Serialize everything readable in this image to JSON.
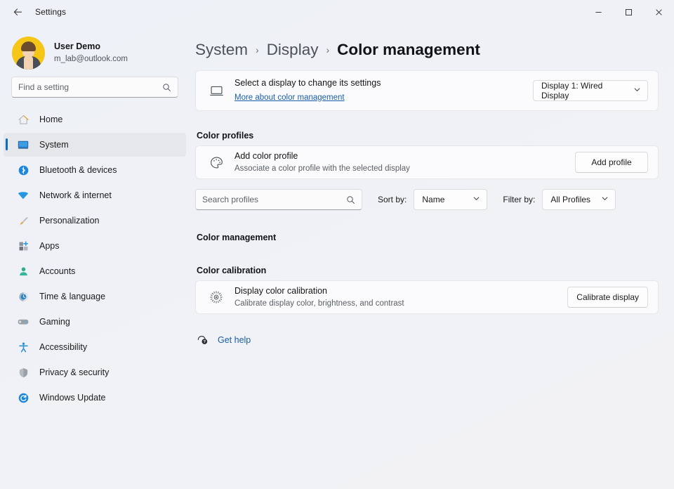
{
  "window": {
    "title": "Settings",
    "back_icon": "back-arrow-icon",
    "minimize_label": "—",
    "maximize_label": "☐",
    "close_label": "✕"
  },
  "account": {
    "name": "User Demo",
    "email": "m_lab@outlook.com",
    "avatar_name": "user-avatar"
  },
  "search": {
    "placeholder": "Find a setting",
    "value": "",
    "icon": "search-icon"
  },
  "sidebar": {
    "items": [
      {
        "label": "Home",
        "icon": "home-icon",
        "active": false
      },
      {
        "label": "System",
        "icon": "system-monitor-icon",
        "active": true
      },
      {
        "label": "Bluetooth & devices",
        "icon": "bluetooth-icon",
        "active": false
      },
      {
        "label": "Network & internet",
        "icon": "wifi-icon",
        "active": false
      },
      {
        "label": "Personalization",
        "icon": "paintbrush-icon",
        "active": false
      },
      {
        "label": "Apps",
        "icon": "apps-icon",
        "active": false
      },
      {
        "label": "Accounts",
        "icon": "account-person-icon",
        "active": false
      },
      {
        "label": "Time & language",
        "icon": "clock-globe-icon",
        "active": false
      },
      {
        "label": "Gaming",
        "icon": "gamepad-icon",
        "active": false
      },
      {
        "label": "Accessibility",
        "icon": "accessibility-person-icon",
        "active": false
      },
      {
        "label": "Privacy & security",
        "icon": "shield-icon",
        "active": false
      },
      {
        "label": "Windows Update",
        "icon": "update-refresh-icon",
        "active": false
      }
    ]
  },
  "breadcrumb": {
    "crumbs": [
      "System",
      "Display"
    ],
    "current": "Color management",
    "separator": "›"
  },
  "display_card": {
    "icon": "monitor-icon",
    "title": "Select a display to change its settings",
    "link": "More about color management",
    "selected_display": "Display 1: Wired Display",
    "chevron": "chevron-down-icon"
  },
  "color_profiles": {
    "section_title": "Color profiles",
    "icon": "color-palette-icon",
    "title": "Add color profile",
    "subtitle": "Associate a color profile with the selected display",
    "button_label": "Add profile"
  },
  "filters": {
    "search_placeholder": "Search profiles",
    "search_value": "",
    "search_icon": "search-icon",
    "sort_label": "Sort by:",
    "sort_value": "Name",
    "filter_label": "Filter by:",
    "filter_value": "All Profiles",
    "chevron": "chevron-down-icon"
  },
  "color_management": {
    "section_title": "Color management"
  },
  "color_calibration": {
    "section_title": "Color calibration",
    "icon": "brightness-sun-icon",
    "title": "Display color calibration",
    "subtitle": "Calibrate display color, brightness, and contrast",
    "button_label": "Calibrate display"
  },
  "get_help": {
    "icon": "help-question-icon",
    "label": "Get help"
  },
  "colors": {
    "accent": "#0f6cbd",
    "link": "#1a5fa8",
    "card_bg": "#fbfbfd",
    "page_bg": "#f0f1f5",
    "avatar_bg": "#f5c518"
  }
}
